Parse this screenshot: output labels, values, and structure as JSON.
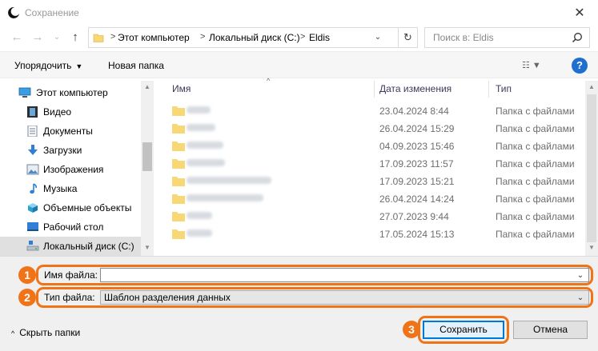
{
  "window": {
    "title": "Сохранение",
    "close_glyph": "✕"
  },
  "nav": {
    "back_glyph": "←",
    "forward_glyph": "→",
    "recent_glyph": "⌄",
    "up_glyph": "↑",
    "breadcrumbs": [
      "Этот компьютер",
      "Локальный диск (C:)",
      "Eldis"
    ],
    "separator": ">",
    "address_dropdown_glyph": "⌄",
    "refresh_glyph": "↻",
    "search_placeholder": "Поиск в: Eldis"
  },
  "toolbar": {
    "organize_label": "Упорядочить",
    "organize_caret": "▼",
    "new_folder_label": "Новая папка",
    "view_glyph": "☷ ▼",
    "help_glyph": "?"
  },
  "sidebar": {
    "items": [
      {
        "label": "Этот компьютер",
        "icon": "computer-icon"
      },
      {
        "label": "Видео",
        "icon": "video-icon"
      },
      {
        "label": "Документы",
        "icon": "documents-icon"
      },
      {
        "label": "Загрузки",
        "icon": "downloads-icon"
      },
      {
        "label": "Изображения",
        "icon": "pictures-icon"
      },
      {
        "label": "Музыка",
        "icon": "music-icon"
      },
      {
        "label": "Объемные объекты",
        "icon": "3d-objects-icon"
      },
      {
        "label": "Рабочий стол",
        "icon": "desktop-icon"
      },
      {
        "label": "Локальный диск (C:)",
        "icon": "drive-icon"
      }
    ],
    "selected_index": 8,
    "scroll_up_glyph": "▲",
    "scroll_down_glyph": "▼"
  },
  "filelist": {
    "columns": {
      "name": "Имя",
      "date": "Дата изменения",
      "type": "Тип"
    },
    "sort_glyph": "^",
    "rows": [
      {
        "date": "23.04.2024 8:44",
        "type": "Папка с файлами"
      },
      {
        "date": "26.04.2024 15:29",
        "type": "Папка с файлами"
      },
      {
        "date": "04.09.2023 15:46",
        "type": "Папка с файлами"
      },
      {
        "date": "17.09.2023 11:57",
        "type": "Папка с файлами"
      },
      {
        "date": "17.09.2023 15:21",
        "type": "Папка с файлами"
      },
      {
        "date": "26.04.2024 14:24",
        "type": "Папка с файлами"
      },
      {
        "date": "27.07.2023 9:44",
        "type": "Папка с файлами"
      },
      {
        "date": "17.05.2024 15:13",
        "type": "Папка с файлами"
      }
    ],
    "scroll_up_glyph": "▲",
    "scroll_down_glyph": "▼"
  },
  "form": {
    "filename_label": "Имя файла:",
    "filename_value": "",
    "filetype_label": "Тип файла:",
    "filetype_value": "Шаблон разделения данных",
    "dropdown_glyph": "⌄"
  },
  "badges": [
    "1",
    "2",
    "3"
  ],
  "footer": {
    "hide_folders_glyph": "^",
    "hide_folders_label": "Скрыть папки",
    "save_label": "Сохранить",
    "cancel_label": "Отмена"
  },
  "colors": {
    "highlight": "#f07318",
    "folder": "#f8d775",
    "accent": "#0078d7",
    "help": "#1e6fd0"
  }
}
